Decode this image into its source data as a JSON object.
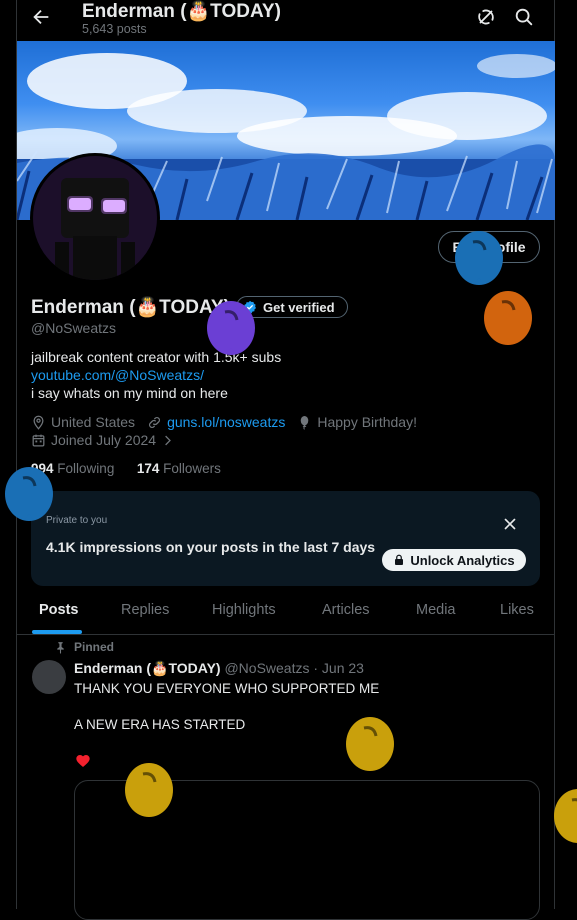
{
  "header": {
    "title": "Enderman (🎂TODAY)",
    "subtitle": "5,643 posts"
  },
  "profile": {
    "edit_label": "Edit profile",
    "name": "Enderman (🎂TODAY)",
    "verify_label": "Get verified",
    "handle": "@NoSweatzs",
    "bio_line1": "jailbreak content creator with 1.5k+ subs",
    "bio_link": "youtube.com/@NoSweatzs/",
    "bio_line3": "i say whats on my mind on here",
    "location": "United States",
    "website": "guns.lol/nosweatzs",
    "birthday": "Happy Birthday!",
    "joined": "Joined July 2024",
    "following_count": "994",
    "following_label": "Following",
    "followers_count": "174",
    "followers_label": "Followers"
  },
  "analytics": {
    "small_label": "Private to you",
    "main_text": "4.1K impressions on your posts in the last 7 days",
    "unlock_label": "Unlock Analytics"
  },
  "tabs": [
    "Posts",
    "Replies",
    "Highlights",
    "Articles",
    "Media",
    "Likes"
  ],
  "post": {
    "pinned_label": "Pinned",
    "author": "Enderman (🎂TODAY)",
    "handle_time": "@NoSweatzs · Jun 23",
    "line1": "THANK YOU EVERYONE WHO SUPPORTED ME",
    "line2": "A NEW ERA HAS STARTED"
  },
  "colors": {
    "accent": "#1d9bf0",
    "background": "#000000",
    "balloon_blue": "#1a6fb5",
    "balloon_purple": "#6b3fd4",
    "balloon_orange": "#d2640e",
    "balloon_yellow": "#c9a00c"
  },
  "icons": [
    "back-arrow-icon",
    "grok-icon",
    "search-icon",
    "verified-badge-icon",
    "location-icon",
    "link-icon",
    "balloon-icon",
    "calendar-icon",
    "chevron-right-icon",
    "close-icon",
    "lock-icon",
    "pin-icon",
    "heart-icon"
  ]
}
